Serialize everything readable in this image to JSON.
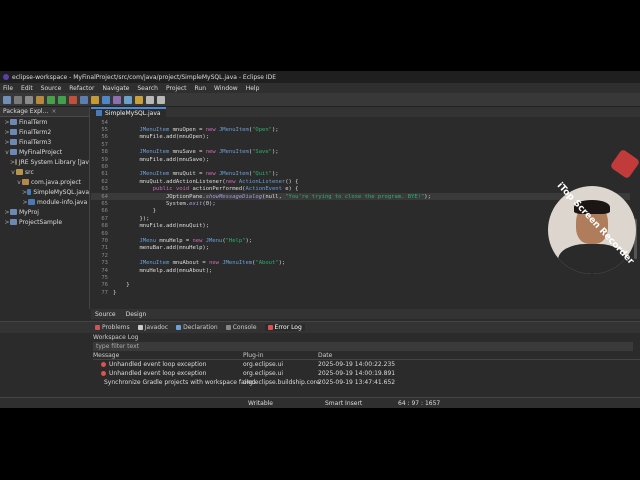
{
  "window": {
    "title": "eclipse-workspace - MyFinalProject/src/com/java/project/SimpleMySQL.java - Eclipse IDE"
  },
  "menu": [
    "File",
    "Edit",
    "Source",
    "Refactor",
    "Navigate",
    "Search",
    "Project",
    "Run",
    "Window",
    "Help"
  ],
  "package_explorer": {
    "tab_label": "Package Expl...",
    "items": [
      {
        "label": "FinalTerm",
        "arrow": ">"
      },
      {
        "label": "FinalTerm2",
        "arrow": ">"
      },
      {
        "label": "FinalTerm3",
        "arrow": ">"
      },
      {
        "label": "MyFinalProject",
        "arrow": "v"
      },
      {
        "label": "JRE System Library [Jav",
        "arrow": ">"
      },
      {
        "label": "src",
        "arrow": "v"
      },
      {
        "label": "com.java.project",
        "arrow": "v"
      },
      {
        "label": "SimpleMySQL.java",
        "arrow": ">"
      },
      {
        "label": "module-info.java",
        "arrow": ">"
      },
      {
        "label": "MyProj",
        "arrow": ">"
      },
      {
        "label": "ProjectSample",
        "arrow": ">"
      }
    ]
  },
  "editor": {
    "tab_label": "SimpleMySQL.java",
    "lines": [
      {
        "num": "54",
        "text": ""
      },
      {
        "num": "55",
        "text": "        JMenuItem mnuOpen = new JMenuItem(\"Open\");"
      },
      {
        "num": "56",
        "text": "        mnuFile.add(mnuOpen);"
      },
      {
        "num": "57",
        "text": ""
      },
      {
        "num": "58",
        "text": "        JMenuItem mnuSave = new JMenuItem(\"Save\");"
      },
      {
        "num": "59",
        "text": "        mnuFile.add(mnuSave);"
      },
      {
        "num": "60",
        "text": ""
      },
      {
        "num": "61",
        "text": "        JMenuItem mnuQuit = new JMenuItem(\"Quit\");"
      },
      {
        "num": "62",
        "text": "        mnuQuit.addActionListener(new ActionListener() {"
      },
      {
        "num": "63",
        "text": "            public void actionPerformed(ActionEvent e) {"
      },
      {
        "num": "64",
        "text": "                JOptionPane.showMessageDialog(null, \"You're trying to close the program. BYE!\");"
      },
      {
        "num": "65",
        "text": "                System.exit(0);"
      },
      {
        "num": "66",
        "text": "            }"
      },
      {
        "num": "67",
        "text": "        });"
      },
      {
        "num": "68",
        "text": "        mnuFile.add(mnuQuit);"
      },
      {
        "num": "69",
        "text": ""
      },
      {
        "num": "70",
        "text": "        JMenu mnuHelp = new JMenu(\"Help\");"
      },
      {
        "num": "71",
        "text": "        menuBar.add(mnuHelp);"
      },
      {
        "num": "72",
        "text": ""
      },
      {
        "num": "73",
        "text": "        JMenuItem mnuAbout = new JMenuItem(\"About\");"
      },
      {
        "num": "74",
        "text": "        mnuHelp.add(mnuAbout);"
      },
      {
        "num": "75",
        "text": ""
      },
      {
        "num": "76",
        "text": "    }"
      },
      {
        "num": "77",
        "text": "}"
      }
    ],
    "source_tabs": [
      "Source",
      "Design"
    ]
  },
  "bottom_panel": {
    "tabs": [
      "Problems",
      "Javadoc",
      "Declaration",
      "Console",
      "Error Log"
    ],
    "view_title": "Workspace Log",
    "filter_placeholder": "type filter text",
    "columns": [
      "Message",
      "Plug-in",
      "Date"
    ],
    "rows": [
      {
        "message": "Unhandled event loop exception",
        "plugin": "org.eclipse.ui",
        "date": "2025-09-19 14:00:22.235"
      },
      {
        "message": "Unhandled event loop exception",
        "plugin": "org.eclipse.ui",
        "date": "2025-09-19 14:00:19.891"
      },
      {
        "message": "Synchronize Gradle projects with workspace failed",
        "plugin": "org.eclipse.buildship.core",
        "date": "2025-09-19 13:47:41.652"
      }
    ]
  },
  "status_bar": {
    "mode": "Writable",
    "insert": "Smart Insert",
    "position": "64 : 97 : 1657"
  },
  "watermark": {
    "text": "iTop Screen Recorder"
  },
  "colors": {
    "keyword": "#cc6cbb",
    "string": "#2fae6f",
    "type": "#6a9fd8",
    "background": "#2b2b2b"
  }
}
